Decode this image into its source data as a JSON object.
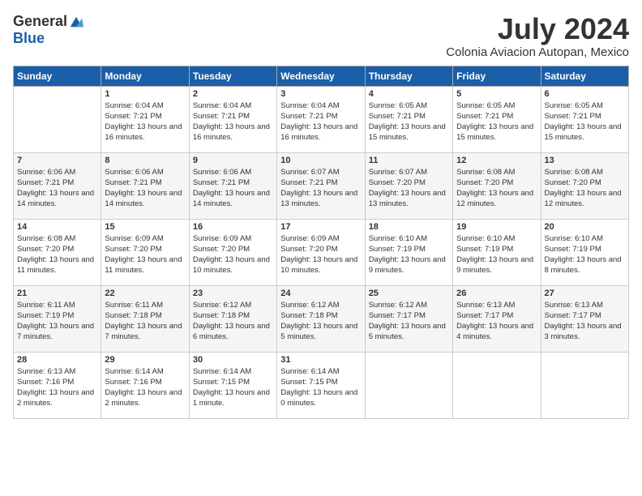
{
  "header": {
    "logo_general": "General",
    "logo_blue": "Blue",
    "month_title": "July 2024",
    "location": "Colonia Aviacion Autopan, Mexico"
  },
  "days_of_week": [
    "Sunday",
    "Monday",
    "Tuesday",
    "Wednesday",
    "Thursday",
    "Friday",
    "Saturday"
  ],
  "weeks": [
    [
      {
        "day": "",
        "sunrise": "",
        "sunset": "",
        "daylight": ""
      },
      {
        "day": "1",
        "sunrise": "Sunrise: 6:04 AM",
        "sunset": "Sunset: 7:21 PM",
        "daylight": "Daylight: 13 hours and 16 minutes."
      },
      {
        "day": "2",
        "sunrise": "Sunrise: 6:04 AM",
        "sunset": "Sunset: 7:21 PM",
        "daylight": "Daylight: 13 hours and 16 minutes."
      },
      {
        "day": "3",
        "sunrise": "Sunrise: 6:04 AM",
        "sunset": "Sunset: 7:21 PM",
        "daylight": "Daylight: 13 hours and 16 minutes."
      },
      {
        "day": "4",
        "sunrise": "Sunrise: 6:05 AM",
        "sunset": "Sunset: 7:21 PM",
        "daylight": "Daylight: 13 hours and 15 minutes."
      },
      {
        "day": "5",
        "sunrise": "Sunrise: 6:05 AM",
        "sunset": "Sunset: 7:21 PM",
        "daylight": "Daylight: 13 hours and 15 minutes."
      },
      {
        "day": "6",
        "sunrise": "Sunrise: 6:05 AM",
        "sunset": "Sunset: 7:21 PM",
        "daylight": "Daylight: 13 hours and 15 minutes."
      }
    ],
    [
      {
        "day": "7",
        "sunrise": "Sunrise: 6:06 AM",
        "sunset": "Sunset: 7:21 PM",
        "daylight": "Daylight: 13 hours and 14 minutes."
      },
      {
        "day": "8",
        "sunrise": "Sunrise: 6:06 AM",
        "sunset": "Sunset: 7:21 PM",
        "daylight": "Daylight: 13 hours and 14 minutes."
      },
      {
        "day": "9",
        "sunrise": "Sunrise: 6:06 AM",
        "sunset": "Sunset: 7:21 PM",
        "daylight": "Daylight: 13 hours and 14 minutes."
      },
      {
        "day": "10",
        "sunrise": "Sunrise: 6:07 AM",
        "sunset": "Sunset: 7:21 PM",
        "daylight": "Daylight: 13 hours and 13 minutes."
      },
      {
        "day": "11",
        "sunrise": "Sunrise: 6:07 AM",
        "sunset": "Sunset: 7:20 PM",
        "daylight": "Daylight: 13 hours and 13 minutes."
      },
      {
        "day": "12",
        "sunrise": "Sunrise: 6:08 AM",
        "sunset": "Sunset: 7:20 PM",
        "daylight": "Daylight: 13 hours and 12 minutes."
      },
      {
        "day": "13",
        "sunrise": "Sunrise: 6:08 AM",
        "sunset": "Sunset: 7:20 PM",
        "daylight": "Daylight: 13 hours and 12 minutes."
      }
    ],
    [
      {
        "day": "14",
        "sunrise": "Sunrise: 6:08 AM",
        "sunset": "Sunset: 7:20 PM",
        "daylight": "Daylight: 13 hours and 11 minutes."
      },
      {
        "day": "15",
        "sunrise": "Sunrise: 6:09 AM",
        "sunset": "Sunset: 7:20 PM",
        "daylight": "Daylight: 13 hours and 11 minutes."
      },
      {
        "day": "16",
        "sunrise": "Sunrise: 6:09 AM",
        "sunset": "Sunset: 7:20 PM",
        "daylight": "Daylight: 13 hours and 10 minutes."
      },
      {
        "day": "17",
        "sunrise": "Sunrise: 6:09 AM",
        "sunset": "Sunset: 7:20 PM",
        "daylight": "Daylight: 13 hours and 10 minutes."
      },
      {
        "day": "18",
        "sunrise": "Sunrise: 6:10 AM",
        "sunset": "Sunset: 7:19 PM",
        "daylight": "Daylight: 13 hours and 9 minutes."
      },
      {
        "day": "19",
        "sunrise": "Sunrise: 6:10 AM",
        "sunset": "Sunset: 7:19 PM",
        "daylight": "Daylight: 13 hours and 9 minutes."
      },
      {
        "day": "20",
        "sunrise": "Sunrise: 6:10 AM",
        "sunset": "Sunset: 7:19 PM",
        "daylight": "Daylight: 13 hours and 8 minutes."
      }
    ],
    [
      {
        "day": "21",
        "sunrise": "Sunrise: 6:11 AM",
        "sunset": "Sunset: 7:19 PM",
        "daylight": "Daylight: 13 hours and 7 minutes."
      },
      {
        "day": "22",
        "sunrise": "Sunrise: 6:11 AM",
        "sunset": "Sunset: 7:18 PM",
        "daylight": "Daylight: 13 hours and 7 minutes."
      },
      {
        "day": "23",
        "sunrise": "Sunrise: 6:12 AM",
        "sunset": "Sunset: 7:18 PM",
        "daylight": "Daylight: 13 hours and 6 minutes."
      },
      {
        "day": "24",
        "sunrise": "Sunrise: 6:12 AM",
        "sunset": "Sunset: 7:18 PM",
        "daylight": "Daylight: 13 hours and 5 minutes."
      },
      {
        "day": "25",
        "sunrise": "Sunrise: 6:12 AM",
        "sunset": "Sunset: 7:17 PM",
        "daylight": "Daylight: 13 hours and 5 minutes."
      },
      {
        "day": "26",
        "sunrise": "Sunrise: 6:13 AM",
        "sunset": "Sunset: 7:17 PM",
        "daylight": "Daylight: 13 hours and 4 minutes."
      },
      {
        "day": "27",
        "sunrise": "Sunrise: 6:13 AM",
        "sunset": "Sunset: 7:17 PM",
        "daylight": "Daylight: 13 hours and 3 minutes."
      }
    ],
    [
      {
        "day": "28",
        "sunrise": "Sunrise: 6:13 AM",
        "sunset": "Sunset: 7:16 PM",
        "daylight": "Daylight: 13 hours and 2 minutes."
      },
      {
        "day": "29",
        "sunrise": "Sunrise: 6:14 AM",
        "sunset": "Sunset: 7:16 PM",
        "daylight": "Daylight: 13 hours and 2 minutes."
      },
      {
        "day": "30",
        "sunrise": "Sunrise: 6:14 AM",
        "sunset": "Sunset: 7:15 PM",
        "daylight": "Daylight: 13 hours and 1 minute."
      },
      {
        "day": "31",
        "sunrise": "Sunrise: 6:14 AM",
        "sunset": "Sunset: 7:15 PM",
        "daylight": "Daylight: 13 hours and 0 minutes."
      },
      {
        "day": "",
        "sunrise": "",
        "sunset": "",
        "daylight": ""
      },
      {
        "day": "",
        "sunrise": "",
        "sunset": "",
        "daylight": ""
      },
      {
        "day": "",
        "sunrise": "",
        "sunset": "",
        "daylight": ""
      }
    ]
  ]
}
